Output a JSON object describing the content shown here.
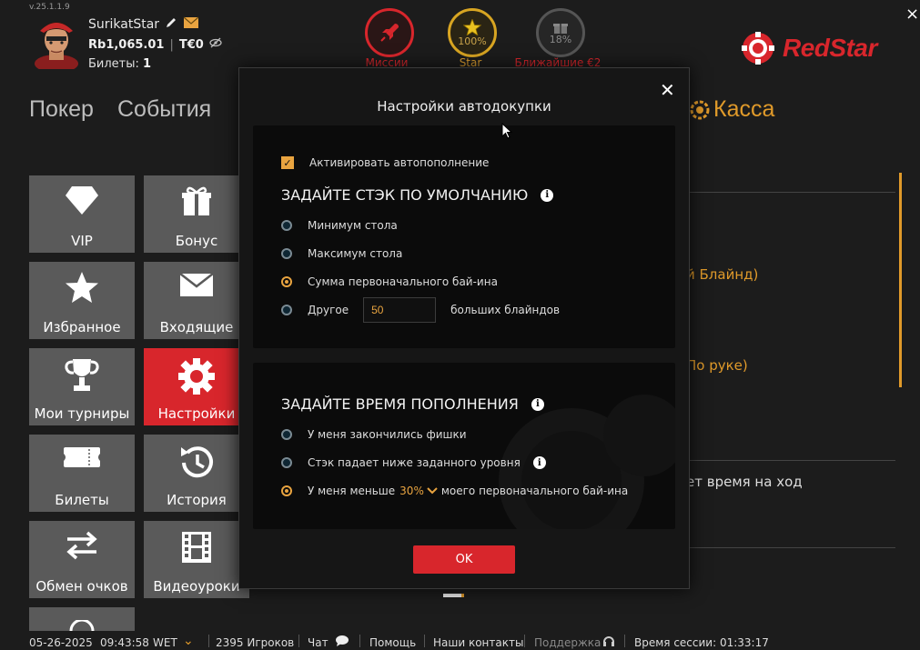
{
  "app": {
    "version": "v.25.1.1.9",
    "close_icon": "×"
  },
  "user": {
    "name": "SurikatStar",
    "balance": "Rb1,065.01",
    "tournament_money": "T€0",
    "tickets_label": "Билеты:",
    "tickets_count": "1"
  },
  "top_icons": {
    "missions_label": "Миссии",
    "star_label": "Star",
    "star_progress": "100%",
    "gift_label": "Ближайшие €2",
    "gift_progress": "18%"
  },
  "brand": {
    "logo_text": "RedStar",
    "color": "#d8262c"
  },
  "nav": {
    "poker": "Покер",
    "events": "События",
    "cashier": "Касса"
  },
  "tiles": [
    {
      "label": "VIP",
      "icon": "diamond-icon"
    },
    {
      "label": "Бонус",
      "icon": "gift-icon"
    },
    {
      "label": "Избранное",
      "icon": "star-icon"
    },
    {
      "label": "Входящие",
      "icon": "envelope-icon"
    },
    {
      "label": "Мои турниры",
      "icon": "trophy-icon"
    },
    {
      "label": "Настройки",
      "icon": "gear-icon"
    },
    {
      "label": "Билеты",
      "icon": "ticket-icon"
    },
    {
      "label": "История",
      "icon": "history-icon"
    },
    {
      "label": "Обмен очков",
      "icon": "exchange-icon"
    },
    {
      "label": "Видеоуроки",
      "icon": "film-icon"
    }
  ],
  "background_fragments": {
    "big_blind": "й Блайнд)",
    "per_hand": "По руке)",
    "time_per_move": "ет время на ход"
  },
  "modal": {
    "title": "Настройки автодокупки",
    "activate_label": "Активировать автопополнение",
    "section1_title": "ЗАДАЙТЕ СТЭК ПО УМОЛЧАНИЮ",
    "stack_options": [
      "Минимум стола",
      "Максимум стола",
      "Сумма первоначального бай-ина",
      "Другое"
    ],
    "other_value": "50",
    "other_suffix": "больших блайндов",
    "section2_title": "ЗАДАЙТЕ ВРЕМЯ ПОПОЛНЕНИЯ",
    "time_options": [
      "У меня закончились фишки",
      "Стэк падает ниже заданного уровня"
    ],
    "less_prefix": "У меня меньше",
    "less_percent": "30%",
    "less_suffix": "моего первоначального бай-ина",
    "ok_label": "OK"
  },
  "statusbar": {
    "date": "05-26-2025",
    "time": "09:43:58",
    "tz": "WET",
    "players": "2395 Игроков",
    "chat": "Чат",
    "help": "Помощь",
    "contacts": "Наши контакты",
    "support": "Поддержка",
    "session": "Время сессии: 01:33:17"
  }
}
